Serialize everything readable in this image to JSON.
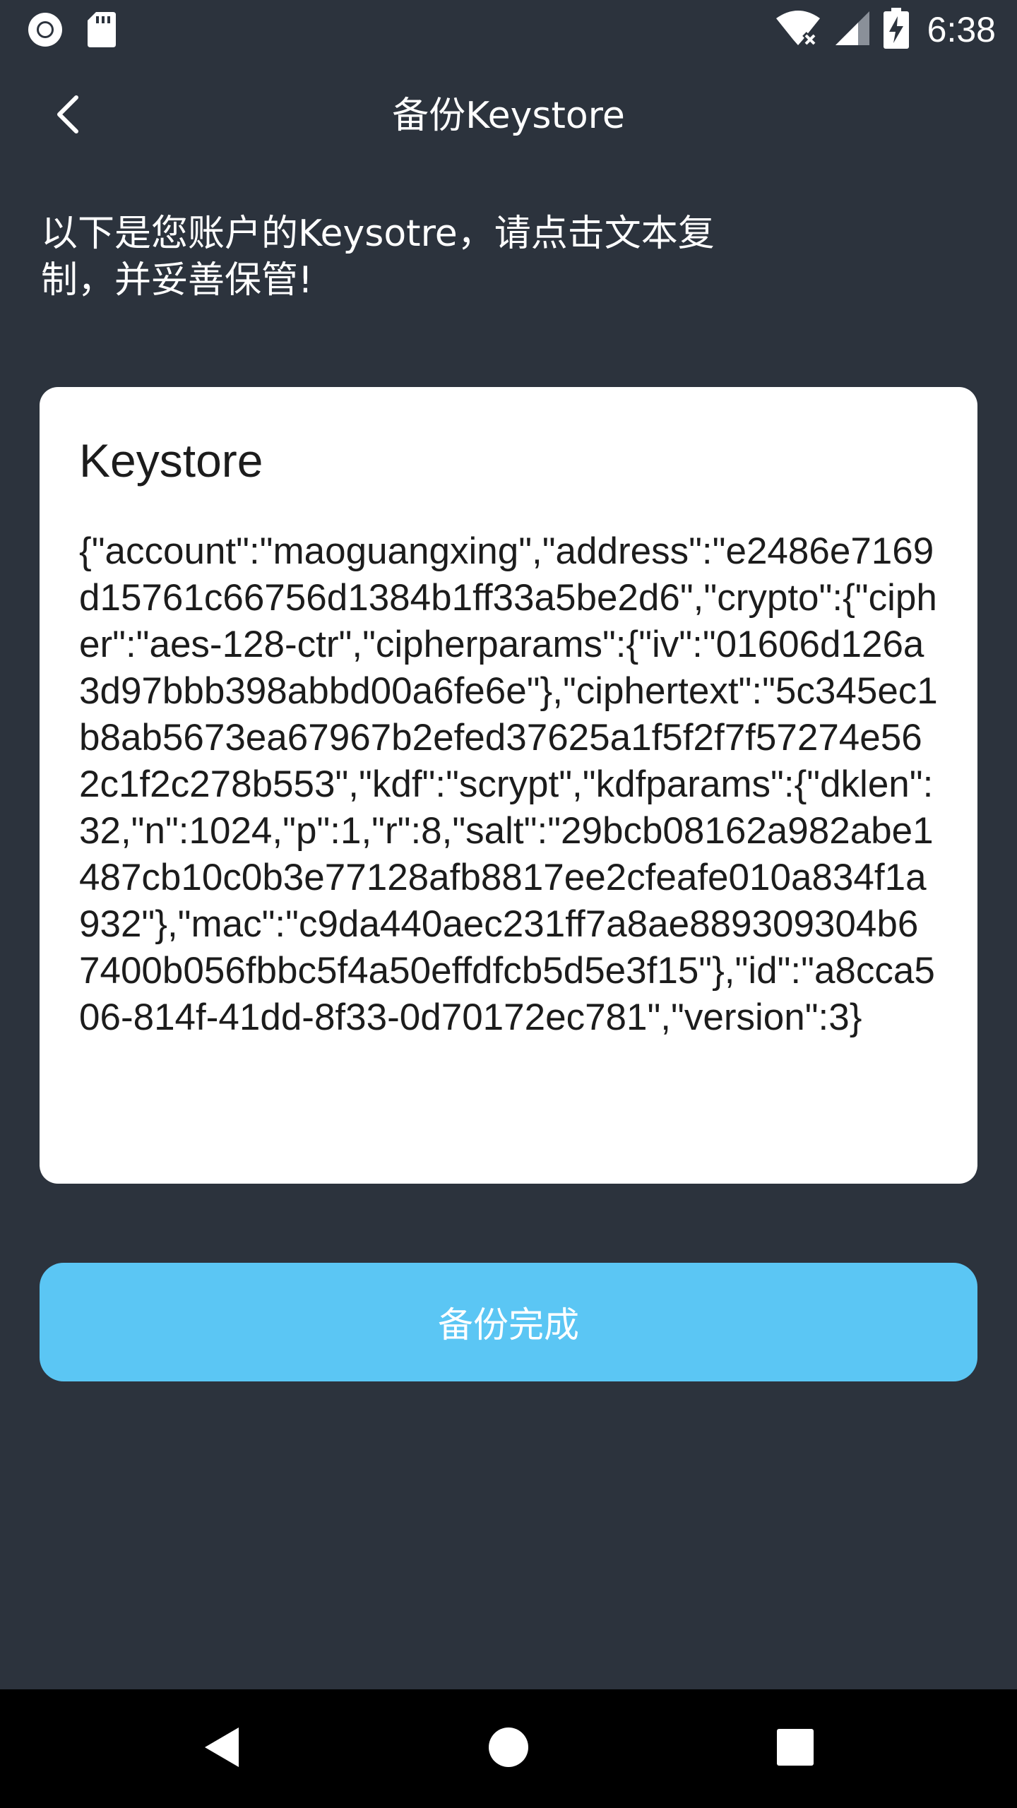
{
  "status_bar": {
    "time": "6:38",
    "icons": [
      "record-icon",
      "sd-card-icon",
      "wifi-off-icon",
      "cell-signal-icon",
      "battery-charging-icon"
    ]
  },
  "toolbar": {
    "title": "备份Keystore",
    "back_icon": "chevron-left-icon"
  },
  "instruction": {
    "text": "以下是您账户的Keysotre，请点击文本复制，并妥善保管!"
  },
  "card": {
    "title": "Keystore",
    "keystore_json": "{\"account\":\"maoguangxing\",\"address\":\"e2486e7169d15761c66756d1384b1ff33a5be2d6\",\"crypto\":{\"cipher\":\"aes-128-ctr\",\"cipherparams\":{\"iv\":\"01606d126a3d97bbb398abbd00a6fe6e\"},\"ciphertext\":\"5c345ec1b8ab5673ea67967b2efed37625a1f5f2f7f57274e562c1f2c278b553\",\"kdf\":\"scrypt\",\"kdfparams\":{\"dklen\":32,\"n\":1024,\"p\":1,\"r\":8,\"salt\":\"29bcb08162a982abe1487cb10c0b3e77128afb8817ee2cfeafe010a834f1a932\"},\"mac\":\"c9da440aec231ff7a8ae889309304b67400b056fbbc5f4a50effdfcb5d5e3f15\"},\"id\":\"a8cca506-814f-41dd-8f33-0d70172ec781\",\"version\":3}"
  },
  "actions": {
    "done_label": "备份完成"
  },
  "nav_bar": {
    "icons": [
      "nav-back-icon",
      "nav-home-icon",
      "nav-recents-icon"
    ]
  },
  "colors": {
    "background": "#2c333d",
    "card": "#ffffff",
    "button": "#5bc6f4",
    "nav_bar": "#000000"
  }
}
